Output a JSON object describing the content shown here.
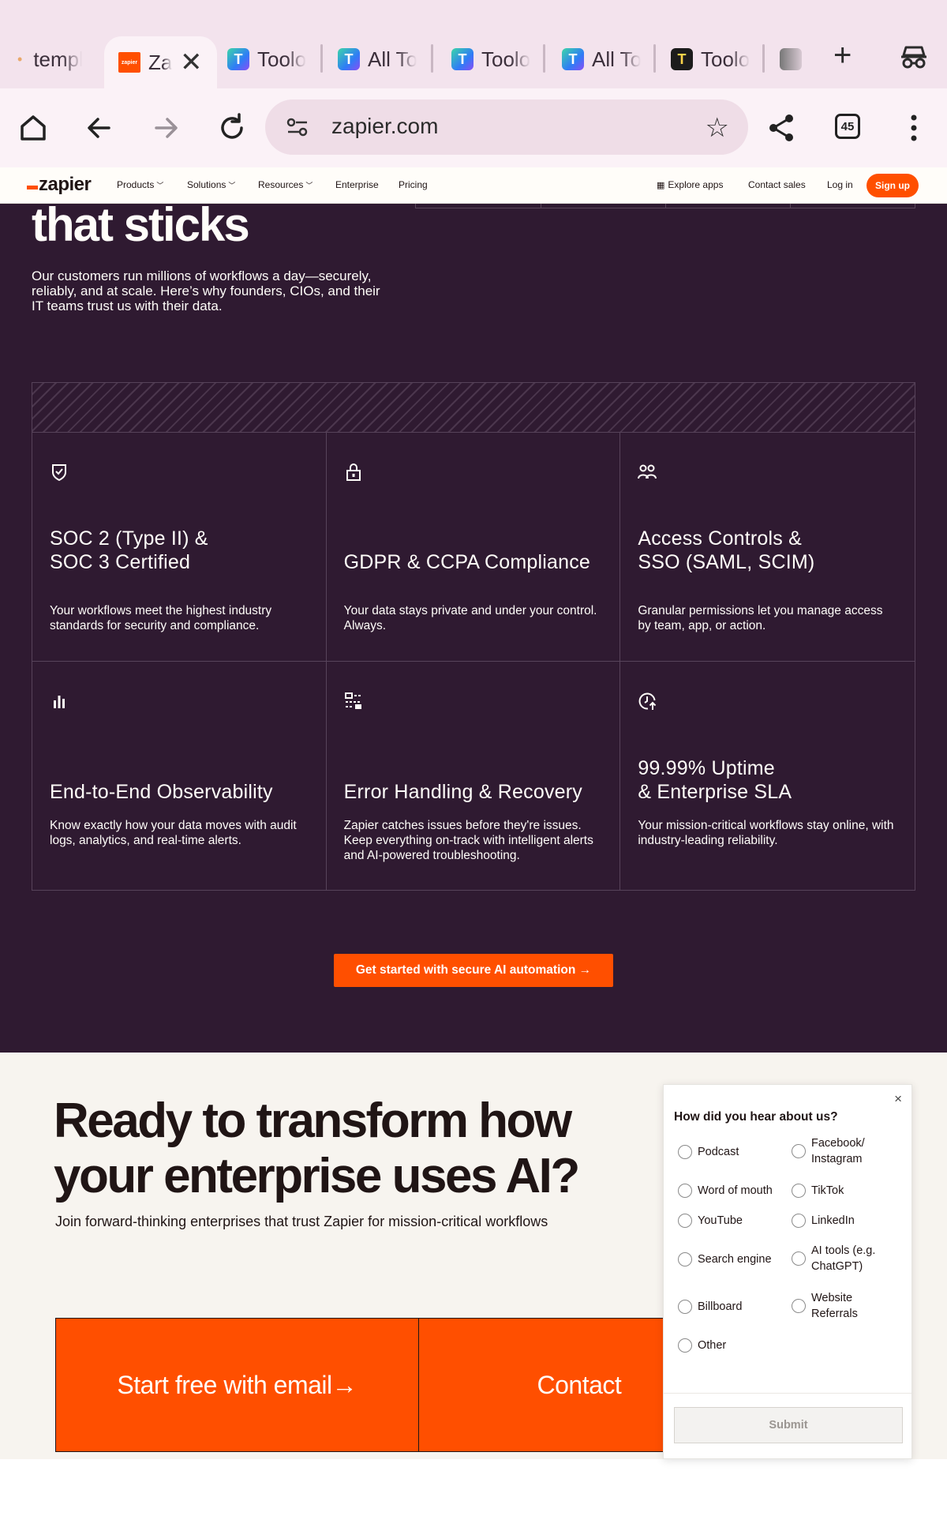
{
  "browser": {
    "tabs": [
      {
        "label": "templ",
        "kind": "dot"
      },
      {
        "label": "Zapier",
        "kind": "zapier",
        "active": true
      },
      {
        "label": "Toolo",
        "kind": "t"
      },
      {
        "label": "All To",
        "kind": "t"
      },
      {
        "label": "Toolo",
        "kind": "t"
      },
      {
        "label": "All To",
        "kind": "t"
      },
      {
        "label": "Toolo",
        "kind": "dark"
      }
    ],
    "active_tab_short": "Za",
    "url": "zapier.com",
    "tab_count": "45"
  },
  "nav": {
    "logo": "zapier",
    "products": "Products",
    "solutions": "Solutions",
    "resources": "Resources",
    "enterprise": "Enterprise",
    "pricing": "Pricing",
    "explore_apps": "Explore apps",
    "contact_sales": "Contact sales",
    "login": "Log in",
    "signup": "Sign up"
  },
  "hero": {
    "title": "that sticks",
    "subtitle": "Our customers run millions of workflows a day—securely, reliably, and at scale. Here’s why founders, CIOs, and their IT teams trust us with their data."
  },
  "features": [
    {
      "icon": "shield-check-icon",
      "title": "SOC 2 (Type II) & SOC 3 Certified",
      "title_l1": "SOC 2 (Type II) &",
      "title_l2": "SOC 3 Certified",
      "desc": "Your workflows meet the highest industry standards for security and compliance."
    },
    {
      "icon": "lock-icon",
      "title_l1": "",
      "title_l2": "GDPR & CCPA Compliance",
      "desc": "Your data stays private and under your control. Always."
    },
    {
      "icon": "users-icon",
      "title_l1": "Access Controls &",
      "title_l2": "SSO (SAML, SCIM)",
      "desc": "Granular permissions let you manage access by team, app, or action."
    },
    {
      "icon": "bar-chart-icon",
      "title_l1": "",
      "title_l2": "End-to-End Observability",
      "desc": "Know exactly how your data moves with audit logs, analytics, and real-time alerts."
    },
    {
      "icon": "workflow-icon",
      "title_l1": "",
      "title_l2": "Error Handling & Recovery",
      "desc": "Zapier catches issues before they're issues. Keep everything on-track with intelligent alerts and AI-powered troubleshooting."
    },
    {
      "icon": "clock-arrow-icon",
      "title_l1": "99.99% Uptime",
      "title_l2": "& Enterprise SLA",
      "desc": "Your mission-critical workflows stay online, with industry-leading reliability."
    }
  ],
  "cta": "Get started with secure AI automation →",
  "ready": {
    "title": "Ready to transform how your enterprise uses AI?",
    "subtitle": "Join forward-thinking enterprises that trust Zapier for mission-critical workflows",
    "btn_email": "Start free with email→",
    "btn_contact": "Contact"
  },
  "survey": {
    "question": "How did you hear about us?",
    "options": [
      "Podcast",
      "Facebook/ Instagram",
      "Word of mouth",
      "TikTok",
      "YouTube",
      "LinkedIn",
      "Search engine",
      "AI tools (e.g. ChatGPT)",
      "Billboard",
      "Website Referrals",
      "Other"
    ],
    "submit": "Submit",
    "close": "×"
  },
  "colors": {
    "brand": "#ff4f00",
    "dark_bg": "#2f1a31",
    "cream_bg": "#f7f4ef"
  }
}
